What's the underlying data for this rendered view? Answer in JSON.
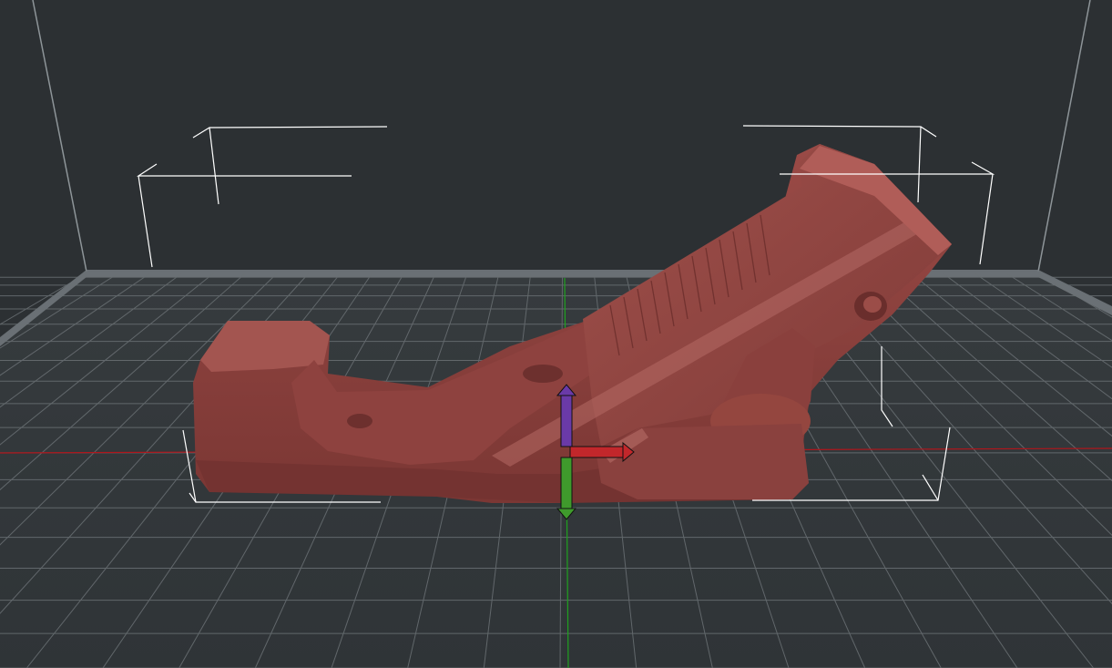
{
  "scene": {
    "background": "#2c3033",
    "plate": {
      "grid_color": "#6a7074",
      "edge_color": "#7b8286",
      "back_wall_color": "#2c3033",
      "back_wall_edge": "#8e9599"
    },
    "axes": {
      "x_axis_color": "#b0161c",
      "y_axis_color": "#1fa11f"
    },
    "model": {
      "name": "",
      "fill": "#8a403d",
      "shade": "#6d302e",
      "highlight": "#b26561",
      "bbox_color": "#ffffff"
    },
    "gizmo": {
      "z_color": "#6a3aa8",
      "x_color": "#c2272b",
      "y_color": "#3f9a2c"
    }
  }
}
